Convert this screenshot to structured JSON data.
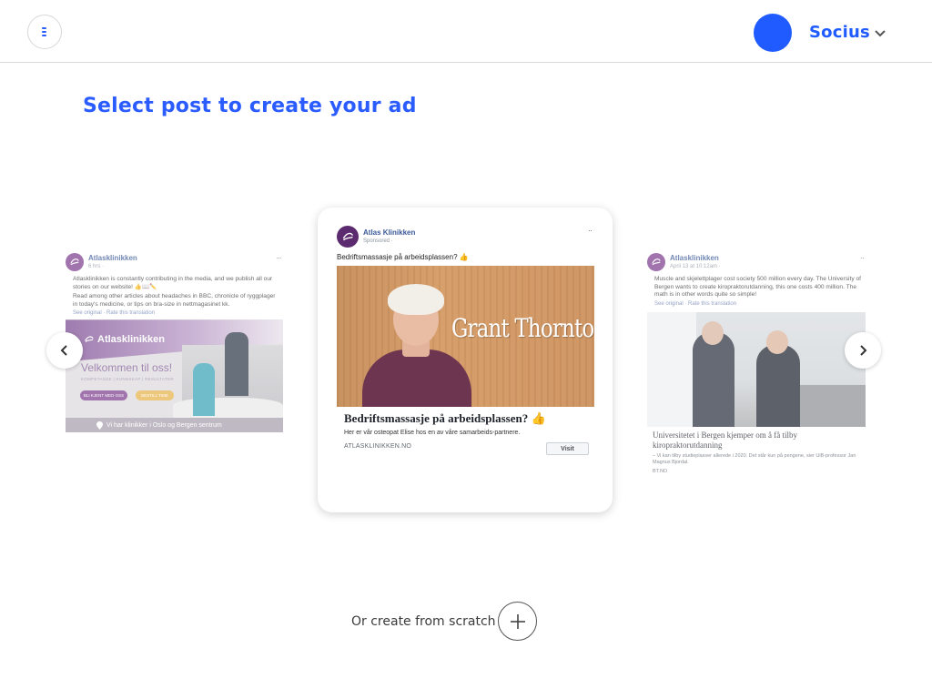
{
  "header": {
    "menu_icon": "menu-icon",
    "account_name": "Socius",
    "avatar_color": "#1f5bff",
    "chevron_icon": "chevron-down-icon"
  },
  "page": {
    "title": "Select post to create your ad"
  },
  "carousel": {
    "prev_icon": "chevron-left-icon",
    "next_icon": "chevron-right-icon",
    "posts": [
      {
        "page_name": "Atlasklinikken",
        "meta": "6 hrs · ",
        "text1": "Atlasklinikken is constantly contributing in the media, and we publish all our stories on our website! 👍📖✏️",
        "text2": "Read among other articles about headaches in BBC, chronicle of ryggplager in today's medicine, or tips on bra-size in nettmagasinet kk.",
        "translate": "See original · Rate this translation",
        "image_brand": "Atlasklinikken",
        "image_welcome": "Velkommen til oss!",
        "image_sub": "KOMPETANSE | KUNNSKAP | RESULTATER",
        "image_btn1": "BLI KJENT MED OSS",
        "image_btn2": "BESTILL TIME",
        "image_footer": "Vi har klinikker i Oslo og Bergen sentrum"
      },
      {
        "page_name": "Atlas Klinikken",
        "meta": "Sponsored · ",
        "text": "Bedriftsmassasje på arbeidsplassen? 👍",
        "image_brand": "Grant Thornton",
        "headline": "Bedriftsmassasje på arbeidsplassen? 👍",
        "description": "Her er vår osteopat Elise hos en av våre samarbeids-partnere.",
        "url": "ATLASKLINIKKEN.NO",
        "cta": "Visit"
      },
      {
        "page_name": "Atlasklinikken",
        "meta": "April 13 at 10:12am · ",
        "text": "Muscle and skjelettplager cost society 500 million every day. The University of Bergen wants to create kiropraktorutdanning, this one costs 400 million. The math is in other words quite so simple!",
        "translate": "See original · Rate this translation",
        "headline": "Universitetet i Bergen kjemper om å få tilby kiropraktorutdanning",
        "small": "– Vi kan tilby studieplasser allerede i 2020. Det står kun på pengene, sier UiB-professor Jan Magnus Bjordal.",
        "url": "BT.NO"
      }
    ]
  },
  "footer": {
    "scratch_label": "Or create from scratch",
    "plus_icon": "plus-icon"
  }
}
